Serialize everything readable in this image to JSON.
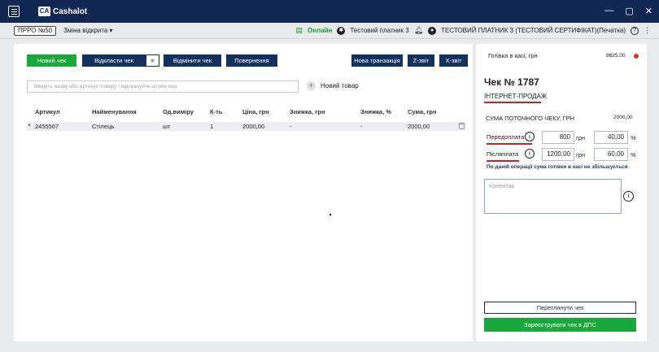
{
  "app": {
    "logo_mark": "CA",
    "logo_text": "Cashalot"
  },
  "window": {
    "minimize": "—",
    "maximize": "▢",
    "close": "✕"
  },
  "toolbar": {
    "prro": "ПРРО №50",
    "shift": "Зміна відкрита ▾",
    "online": "Онлайн",
    "payer": "Тестовий платник 3",
    "certificate": "ТЕСТОВИЙ ПЛАТНИК 3 (ТЕСТОВИЙ СЕРТИФІКАТ)(Печатка)",
    "help": "?"
  },
  "actions": {
    "new_receipt": "Новий чек",
    "postpone": "Відкласти чек",
    "cancel": "Відмінити чек",
    "return": "Повернення",
    "new_transaction": "Нова транзакція",
    "z_report": "Z-звіт",
    "x_report": "X-звіт"
  },
  "search": {
    "placeholder": "Введіть назву або артикул товару / відскануйте штрих-код"
  },
  "new_item_label": "Новий товар",
  "table": {
    "headers": [
      "Артикул",
      "Найменування",
      "Од.виміру",
      "К-ть",
      "Ціна, грн",
      "Знижка, грн",
      "Знижка, %",
      "Сума, грн"
    ],
    "rows": [
      {
        "sku": "2455567",
        "name": "Стілець",
        "unit": "шт",
        "qty": "1",
        "price": "2000,00",
        "discount_uah": "-",
        "discount_pct": "-",
        "sum": "2000,00"
      }
    ]
  },
  "side": {
    "cash_label": "Готівка в касі, грн",
    "cash_value": "8625,00",
    "receipt_title": "Чек № 1787",
    "sale_type": "ІНТЕРНЕТ-ПРОДАЖ",
    "sum_label": "СУМА ПОТОЧНОГО ЧЕКУ, ГРН",
    "sum_value": "2000,00",
    "prepayment": {
      "label": "Передоплата",
      "amount": "800",
      "currency": "грн",
      "percent": "40,00",
      "pct_sign": "%"
    },
    "postpayment": {
      "label": "Післяплата",
      "amount": "1200,00",
      "currency": "грн",
      "percent": "60,00",
      "pct_sign": "%"
    },
    "note": "По даній операції сума готівки в касі не збільшується",
    "comment_placeholder": "Коментар",
    "view_receipt": "Переглянути чек",
    "register": "Зареєструвати чек в ДПС"
  },
  "colors": {
    "navy": "#112855",
    "green": "#1aa83a",
    "red": "#d32020"
  }
}
